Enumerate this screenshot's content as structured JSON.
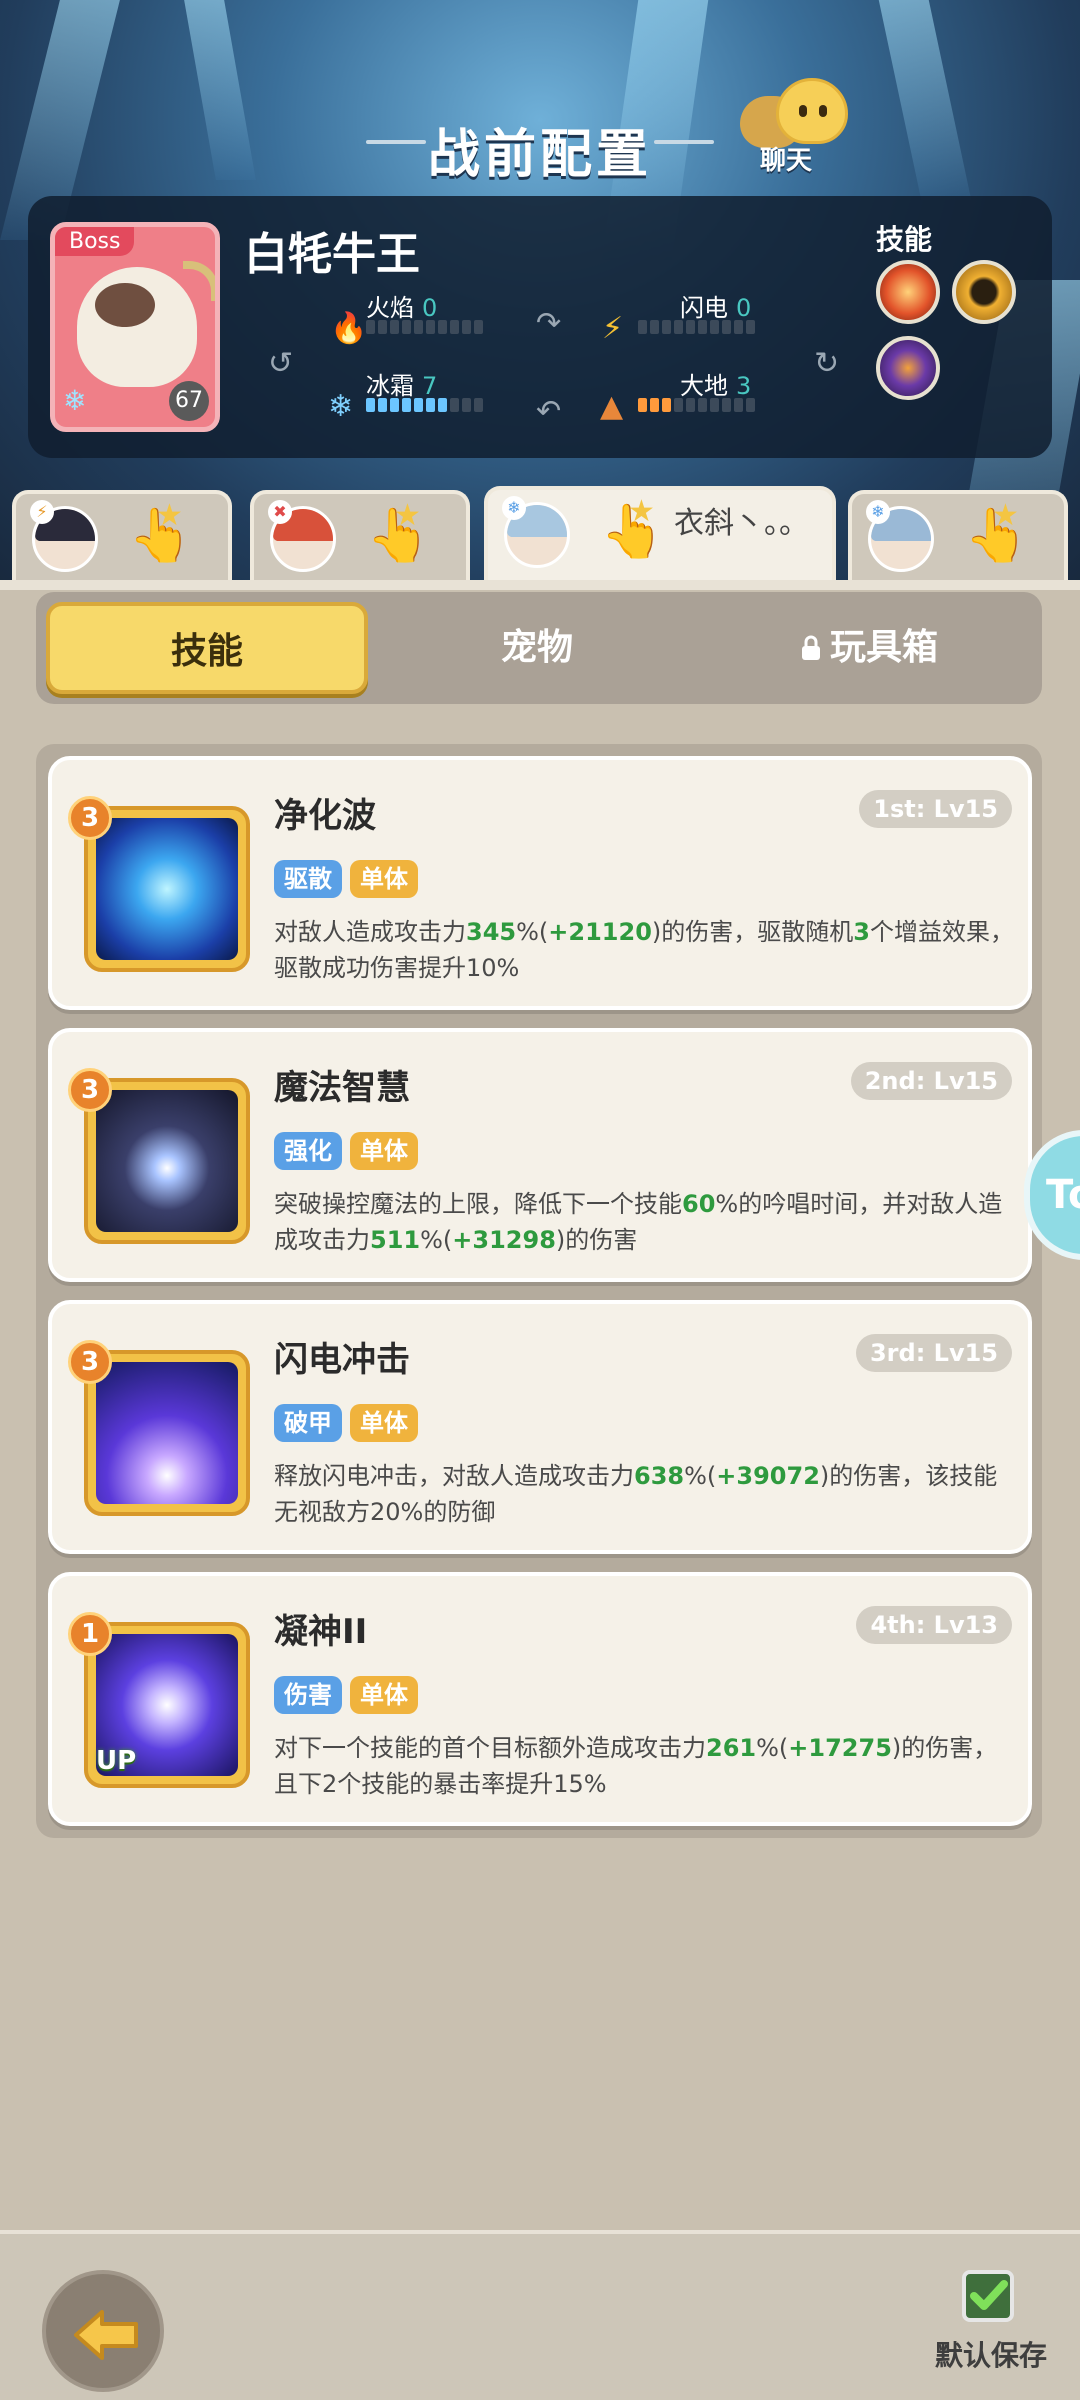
{
  "header": {
    "title": "战前配置",
    "chat_label": "聊天"
  },
  "boss": {
    "tag": "Boss",
    "name": "白牦牛王",
    "level": "67",
    "elements": {
      "fire": {
        "label": "火焰",
        "value": "0",
        "color": "#ff7b4a",
        "filled": 0
      },
      "lightning": {
        "label": "闪电",
        "value": "0",
        "color": "#ffd23a",
        "filled": 0
      },
      "ice": {
        "label": "冰霜",
        "value": "7",
        "color": "#6cc6ff",
        "filled": 7
      },
      "earth": {
        "label": "大地",
        "value": "3",
        "color": "#ff9a3c",
        "filled": 3
      }
    },
    "skills_label": "技能",
    "skill_icons": [
      "fire-orb-icon",
      "golden-ring-icon",
      "purple-mask-icon"
    ]
  },
  "heroes": [
    {
      "name": "",
      "selected": false,
      "hair_color": "#2a2a3a"
    },
    {
      "name": "",
      "selected": false,
      "hair_color": "#d8513a"
    },
    {
      "name": "衣斜丶。。",
      "selected": true,
      "hair_color": "#a8c7e0"
    },
    {
      "name": "",
      "selected": false,
      "hair_color": "#9ab9d6"
    }
  ],
  "main_tabs": [
    {
      "label": "技能",
      "active": true
    },
    {
      "label": "宠物",
      "active": false
    },
    {
      "label": "玩具箱",
      "active": false,
      "locked": true
    }
  ],
  "skills": [
    {
      "rank": "3",
      "name": "净化波",
      "slot": "1st: Lv15",
      "tags": [
        "驱散",
        "单体"
      ],
      "desc_parts": [
        "对敌人造成攻击力",
        "345",
        "%(",
        "+21120",
        ")的伤害，驱散随机",
        "3",
        "个增益效果，驱散成功伤害提升10%"
      ],
      "up": false
    },
    {
      "rank": "3",
      "name": "魔法智慧",
      "slot": "2nd: Lv15",
      "tags": [
        "强化",
        "单体"
      ],
      "desc_parts": [
        "突破操控魔法的上限，降低下一个技能",
        "60",
        "%的吟唱时间，并对敌人造成攻击力",
        "511",
        "%(",
        "+31298",
        ")的伤害"
      ],
      "up": false
    },
    {
      "rank": "3",
      "name": "闪电冲击",
      "slot": "3rd: Lv15",
      "tags": [
        "破甲",
        "单体"
      ],
      "desc_parts": [
        "释放闪电冲击，对敌人造成攻击力",
        "638",
        "%(",
        "+39072",
        ")的伤害，该技能无视敌方20%的防御"
      ],
      "up": false
    },
    {
      "rank": "1",
      "name": "凝神II",
      "slot": "4th: Lv13",
      "tags": [
        "伤害",
        "单体"
      ],
      "desc_parts": [
        "对下一个技能的首个目标额外造成攻击力",
        "261",
        "%(",
        "+17275",
        ")的伤害，且下2个技能的暴击率提升15%"
      ],
      "up": true,
      "up_label": "UP"
    }
  ],
  "side_pill_text": "To",
  "footer": {
    "save_label": "默认保存",
    "save_checked": true
  }
}
